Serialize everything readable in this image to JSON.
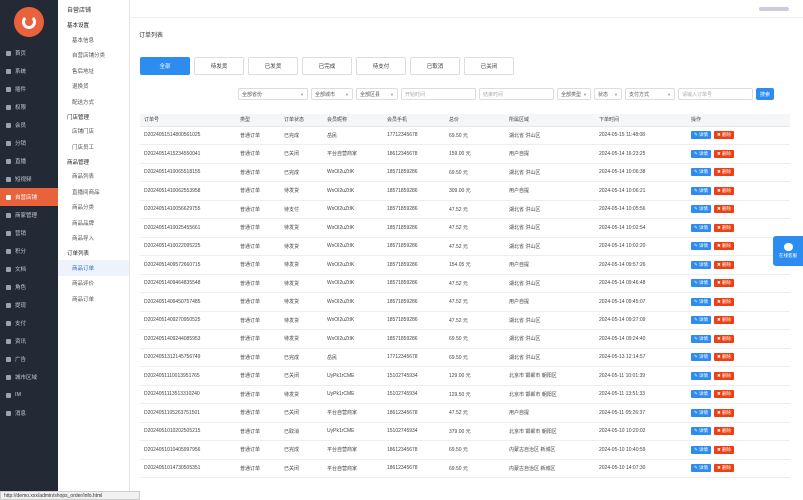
{
  "nav": {
    "items": [
      {
        "label": "首页",
        "active": false
      },
      {
        "label": "系统",
        "active": false
      },
      {
        "label": "插件",
        "active": false
      },
      {
        "label": "权限",
        "active": false
      },
      {
        "label": "会员",
        "active": false
      },
      {
        "label": "分销",
        "active": false
      },
      {
        "label": "直播",
        "active": false
      },
      {
        "label": "短视频",
        "active": false
      },
      {
        "label": "自营店铺",
        "active": true
      },
      {
        "label": "商家管理",
        "active": false
      },
      {
        "label": "营销",
        "active": false
      },
      {
        "label": "积分",
        "active": false
      },
      {
        "label": "文档",
        "active": false
      },
      {
        "label": "角色",
        "active": false
      },
      {
        "label": "提现",
        "active": false
      },
      {
        "label": "支付",
        "active": false
      },
      {
        "label": "资讯",
        "active": false
      },
      {
        "label": "广告",
        "active": false
      },
      {
        "label": "城市区域",
        "active": false
      },
      {
        "label": "IM",
        "active": false
      },
      {
        "label": "消息",
        "active": false
      }
    ]
  },
  "sub": {
    "title": "自营店铺",
    "groups": [
      {
        "label": "基本设置",
        "items": [
          {
            "label": "基本信息",
            "active": false
          },
          {
            "label": "自营店铺分类",
            "active": false
          },
          {
            "label": "售后地址",
            "active": false
          },
          {
            "label": "退换货",
            "active": false
          },
          {
            "label": "配送方式",
            "active": false
          }
        ]
      },
      {
        "label": "门店管理",
        "items": [
          {
            "label": "店铺门店",
            "active": false
          },
          {
            "label": "门店员工",
            "active": false
          }
        ]
      },
      {
        "label": "商品管理",
        "items": [
          {
            "label": "商品列表",
            "active": false
          },
          {
            "label": "直播间商品",
            "active": false
          },
          {
            "label": "商品分类",
            "active": false
          },
          {
            "label": "商品品牌",
            "active": false
          },
          {
            "label": "商品导入",
            "active": false
          }
        ]
      },
      {
        "label": "订单列表",
        "items": [
          {
            "label": "商品订单",
            "active": true
          },
          {
            "label": "商品评价",
            "active": false
          },
          {
            "label": "商品订单",
            "active": false
          }
        ]
      }
    ]
  },
  "page": {
    "crumb": "订单列表"
  },
  "tabs": [
    {
      "label": "全部",
      "active": true
    },
    {
      "label": "待发货",
      "active": false
    },
    {
      "label": "已发货",
      "active": false
    },
    {
      "label": "已完成",
      "active": false
    },
    {
      "label": "待支付",
      "active": false
    },
    {
      "label": "已取消",
      "active": false
    },
    {
      "label": "已关闭",
      "active": false
    }
  ],
  "filters": {
    "province": "全部省份",
    "city": "全部城市",
    "district": "全部区县",
    "start": "开始时间",
    "end": "结束时间",
    "type": "全部类型",
    "status": "状态",
    "pay": "支付方式",
    "keyword_placeholder": "请输入订单号",
    "search": "搜索"
  },
  "table": {
    "headers": [
      "订单号",
      "类型",
      "订单状态",
      "会员昵称",
      "会员手机",
      "总价",
      "所属区域",
      "下单时间",
      "操作"
    ],
    "edit_label": "✎ 详情",
    "del_label": "✖ 删除",
    "rows": [
      {
        "id": "D2024051514800561025",
        "type": "普通订单",
        "status": "已完成",
        "st": "ok",
        "nick": "岳民",
        "phone": "17712345678",
        "total": "69.50 元",
        "area": "湖北省 洪山区",
        "time": "2024-05-15 11:48:08"
      },
      {
        "id": "D2024051415234550041",
        "type": "普通订单",
        "status": "已关闭",
        "st": "closed",
        "nick": "平台自营商家",
        "phone": "18612345678",
        "total": "159.00 元",
        "area": "用户自提",
        "time": "2024-05-14 16:23:25"
      },
      {
        "id": "D2024051410065518155",
        "type": "普通订单",
        "status": "已完成",
        "st": "ok",
        "nick": "WxOI2uZtIK",
        "phone": "18571859286",
        "total": "69.50 元",
        "area": "湖北省 洪山区",
        "time": "2024-05-14 10:06:38"
      },
      {
        "id": "D2024051410062553958",
        "type": "普通订单",
        "status": "待发货",
        "st": "wait",
        "nick": "WxOI2uZtIK",
        "phone": "18571859286",
        "total": "309.00 元",
        "area": "用户自提",
        "time": "2024-05-14 10:06:21"
      },
      {
        "id": "D2024051410056629755",
        "type": "普通订单",
        "status": "待支付",
        "st": "pay",
        "nick": "WxOI2uZtIK",
        "phone": "18571859286",
        "total": "47.52 元",
        "area": "湖北省 洪山区",
        "time": "2024-05-14 10:05:56"
      },
      {
        "id": "D2024051410025455661",
        "type": "普通订单",
        "status": "待发货",
        "st": "wait",
        "nick": "WxOI2uZtIK",
        "phone": "18571859286",
        "total": "47.52 元",
        "area": "湖北省 洪山区",
        "time": "2024-05-14 10:02:54"
      },
      {
        "id": "D2024051410022095225",
        "type": "普通订单",
        "status": "待发货",
        "st": "wait",
        "nick": "WxOI2uZtIK",
        "phone": "18571859286",
        "total": "47.52 元",
        "area": "湖北省 洪山区",
        "time": "2024-05-14 10:02:20"
      },
      {
        "id": "D2024051409572660715",
        "type": "普通订单",
        "status": "待发货",
        "st": "wait",
        "nick": "WxOI2uZtIK",
        "phone": "18571859286",
        "total": "154.05 元",
        "area": "用户自提",
        "time": "2024-05-14 09:57:26"
      },
      {
        "id": "D2024051409464835548",
        "type": "普通订单",
        "status": "待发货",
        "st": "wait",
        "nick": "WxOI2uZtIK",
        "phone": "18571859286",
        "total": "47.52 元",
        "area": "湖北省 洪山区",
        "time": "2024-05-14 09:46:48"
      },
      {
        "id": "D2024051409450757485",
        "type": "普通订单",
        "status": "待发货",
        "st": "wait",
        "nick": "WxOI2uZtIK",
        "phone": "18571859286",
        "total": "47.52 元",
        "area": "用户自提",
        "time": "2024-05-14 09:45:07"
      },
      {
        "id": "D2024051409270950525",
        "type": "普通订单",
        "status": "待发货",
        "st": "wait",
        "nick": "WxOI2uZtIK",
        "phone": "18571859286",
        "total": "47.52 元",
        "area": "湖北省 洪山区",
        "time": "2024-05-14 09:27:09"
      },
      {
        "id": "D2024051409244085953",
        "type": "普通订单",
        "status": "待发货",
        "st": "wait",
        "nick": "WxOI2uZtIK",
        "phone": "18571859286",
        "total": "69.50 元",
        "area": "湖北省 洪山区",
        "time": "2024-05-14 09:24:40"
      },
      {
        "id": "D2024051312145756749",
        "type": "普通订单",
        "status": "已完成",
        "st": "ok",
        "nick": "岳民",
        "phone": "17712345678",
        "total": "69.50 元",
        "area": "湖北省 洪山区",
        "time": "2024-05-13 12:14:57"
      },
      {
        "id": "D2024051110013951765",
        "type": "普通订单",
        "status": "已关闭",
        "st": "closed",
        "nick": "UyPk1rCME",
        "phone": "15102745934",
        "total": "129.00 元",
        "area": "北京市 邯郸市 朝阳区",
        "time": "2024-05-11 10:01:39"
      },
      {
        "id": "D2024051113513310240",
        "type": "普通订单",
        "status": "待发货",
        "st": "wait",
        "nick": "UyPk1rCME",
        "phone": "15102745934",
        "total": "129.50 元",
        "area": "北京市 邯郸市 朝阳区",
        "time": "2024-05-11 13:51:33"
      },
      {
        "id": "D2024051105263751501",
        "type": "普通订单",
        "status": "已关闭",
        "st": "closed",
        "nick": "平台自营商家",
        "phone": "18612345678",
        "total": "47.52 元",
        "area": "用户自提",
        "time": "2024-05-11 05:26:37"
      },
      {
        "id": "D2024051010202505215",
        "type": "普通订单",
        "status": "已取消",
        "st": "closed",
        "nick": "UyPk1rCME",
        "phone": "15102745934",
        "total": "379.00 元",
        "area": "北京市 邯郸市 朝阳区",
        "time": "2024-05-10 10:20:02"
      },
      {
        "id": "D2024051010405997956",
        "type": "普通订单",
        "status": "已完成",
        "st": "pay",
        "nick": "平台自营商家",
        "phone": "18612345678",
        "total": "69.50 元",
        "area": "内蒙古自治区 新城区",
        "time": "2024-05-10 10:40:59"
      },
      {
        "id": "D2024051014730505351",
        "type": "普通订单",
        "status": "已关闭",
        "st": "closed",
        "nick": "平台自营商家",
        "phone": "18612345678",
        "total": "69.50 元",
        "area": "内蒙古自治区 新城区",
        "time": "2024-05-10 14:07:30"
      }
    ]
  },
  "float": {
    "label": "在线客服"
  },
  "status_bar": "http://demo.xxx/admin/shops_order/info.html"
}
